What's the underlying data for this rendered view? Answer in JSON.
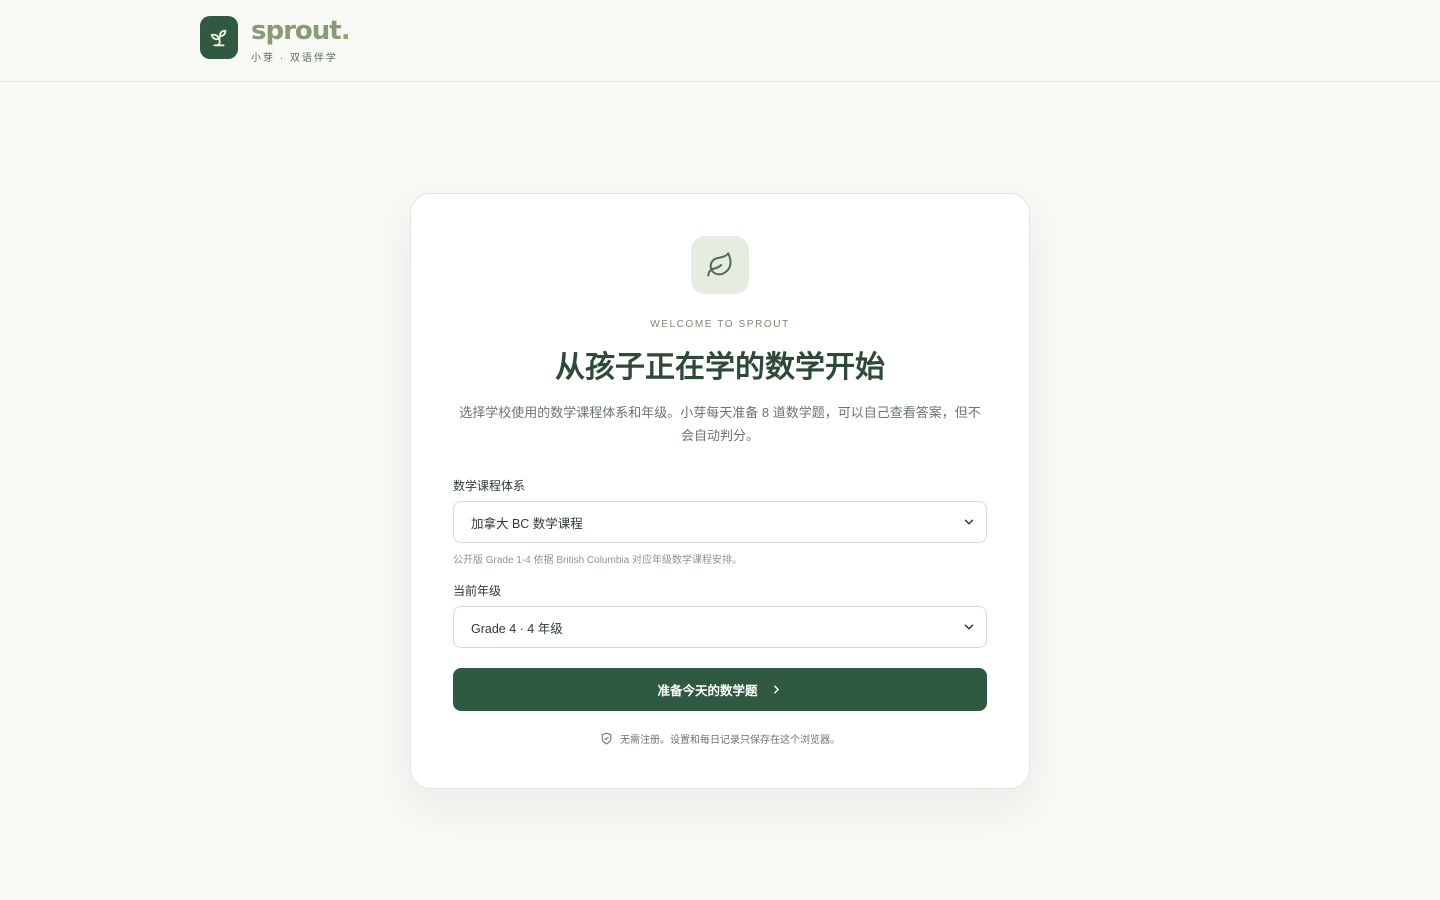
{
  "brand": {
    "name": "sprout",
    "name_dot": ".",
    "tagline": "小芽 · 双语伴学",
    "icon": "sprout-icon"
  },
  "card": {
    "badge_icon": "leaf-icon",
    "eyebrow": "WELCOME TO SPROUT",
    "title": "从孩子正在学的数学开始",
    "description": "选择学校使用的数学课程体系和年级。小芽每天准备 8 道数学题，可以自己查看答案，但不会自动判分。"
  },
  "form": {
    "curriculum_label": "数学课程体系",
    "curriculum_value": "加拿大 BC 数学课程",
    "curriculum_hint": "公开版 Grade 1-4 依据 British Columbia 对应年级数学课程安排。",
    "grade_label": "当前年级",
    "grade_value": "Grade 4 · 4 年级",
    "submit_label": "准备今天的数学题",
    "privacy_note": "无需注册。设置和每日记录只保存在这个浏览器。"
  },
  "colors": {
    "accent": "#2f5a41",
    "brand_text": "#8a9a73",
    "background": "#f8f8f5",
    "badge_bg": "#e6ecdf"
  }
}
